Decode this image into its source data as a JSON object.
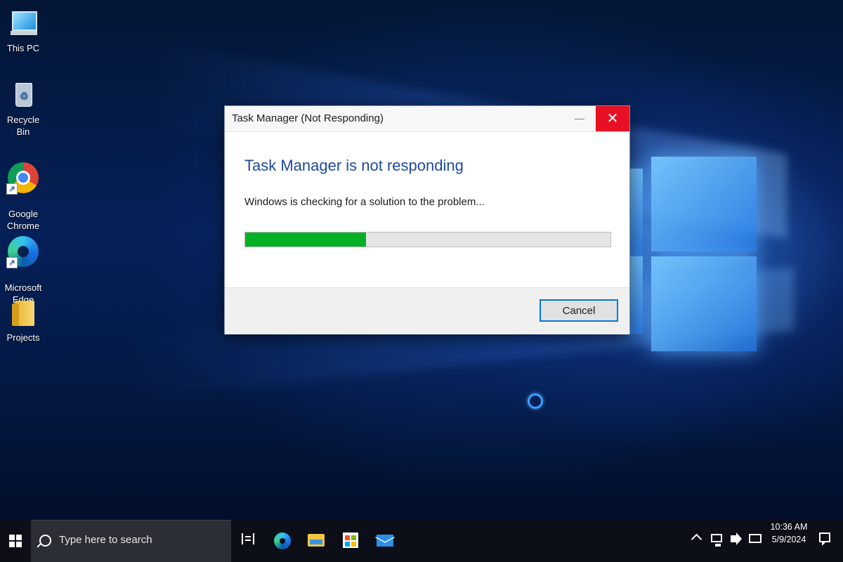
{
  "desktop": {
    "icons": [
      {
        "label": "This PC"
      },
      {
        "label": "Recycle Bin"
      },
      {
        "label": "Google\nChrome"
      },
      {
        "label": "Microsoft\nEdge"
      },
      {
        "label": "Projects"
      }
    ]
  },
  "dialog": {
    "title": "Task Manager (Not Responding)",
    "heading": "Task Manager is not responding",
    "message": "Windows is checking for a solution to the problem...",
    "progress_fraction": 0.33,
    "minimize_glyph": "—",
    "close_glyph": "✕",
    "cancel_label": "Cancel",
    "colors": {
      "heading": "#1e4a9c",
      "progress": "#06b025",
      "close": "#e81123",
      "focus": "#0078d7"
    }
  },
  "taskbar": {
    "search_placeholder": "Type here to search",
    "pinned": [
      "task-view-icon",
      "edge-icon",
      "file-explorer-icon",
      "store-icon",
      "mail-icon"
    ],
    "time": "10:36 AM",
    "date": "5/9/2024"
  }
}
